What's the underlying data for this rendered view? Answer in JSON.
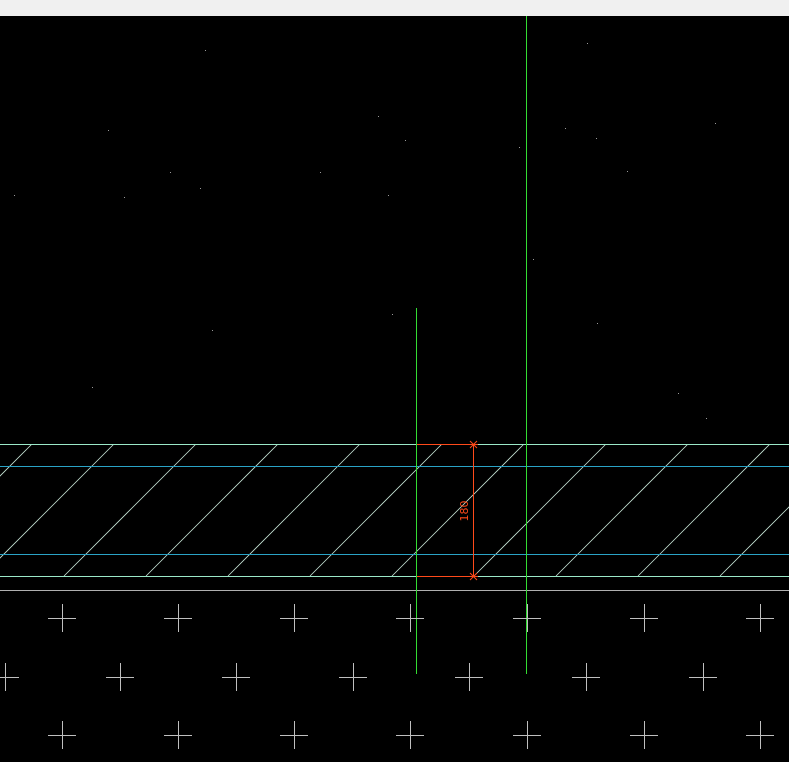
{
  "window": {
    "title_bar_color": "#f0f0f0"
  },
  "canvas": {
    "background": "#000000",
    "colors": {
      "slab_outline": "#9be8c8",
      "slab_inner": "#2aa3c6",
      "hatch": "#c8e6d8",
      "guide_line": "#33dd33",
      "dimension": "#ff4a1a",
      "crosshair": "#bfbfbf",
      "ground_line": "#b0b0b0",
      "dots": "#9a9a9a"
    },
    "dimension": {
      "value": "180"
    },
    "icons": {
      "grid_marker": "plus-crosshair-icon"
    }
  }
}
